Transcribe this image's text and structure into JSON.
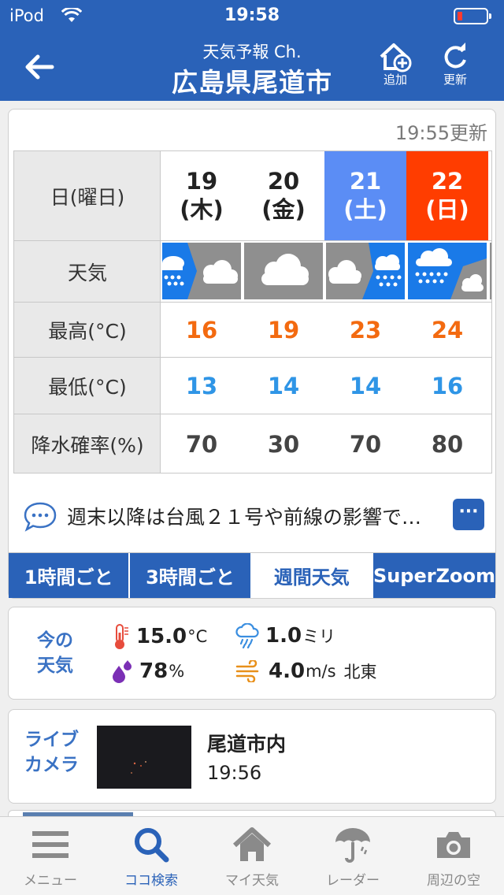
{
  "status_bar": {
    "carrier": "iPod",
    "time": "19:58",
    "battery_color": "#ff3b30"
  },
  "nav": {
    "subtitle": "天気予報 Ch.",
    "title": "広島県尾道市",
    "add_label": "追加",
    "refresh_label": "更新"
  },
  "forecast": {
    "updated": "19:55更新",
    "row_labels": {
      "day": "日(曜日)",
      "weather": "天気",
      "high": "最高(°C)",
      "low": "最低(°C)",
      "pop": "降水確率(%)"
    },
    "days": [
      {
        "date": "19",
        "weekday": "(木)",
        "weather": "rain-to-cloudy",
        "high": "16",
        "low": "13",
        "pop": "70"
      },
      {
        "date": "20",
        "weekday": "(金)",
        "weather": "cloudy",
        "high": "19",
        "low": "14",
        "pop": "30"
      },
      {
        "date": "21",
        "weekday": "(土)",
        "weather": "cloudy-to-rain",
        "high": "23",
        "low": "14",
        "pop": "70"
      },
      {
        "date": "22",
        "weekday": "(日)",
        "weather": "rain-to-cloudy",
        "high": "24",
        "low": "16",
        "pop": "80"
      }
    ],
    "comment": "週末以降は台風２１号や前線の影響で…",
    "more_label": "···",
    "tabs": [
      "1時間ごと",
      "3時間ごと",
      "週間天気",
      "SuperZoom"
    ],
    "active_tab": "週間天気",
    "colors": {
      "saturday": "#5b8df5",
      "sunday": "#ff3d00",
      "high": "#f36a10",
      "low": "#2f95e6",
      "rain": "#1a7ae8",
      "cloud": "#8f8f8f"
    }
  },
  "current": {
    "label_line1": "今の",
    "label_line2": "天気",
    "temperature": "15.0",
    "temperature_unit": "°C",
    "precip": "1.0",
    "precip_unit": "ミリ",
    "humidity": "78",
    "humidity_unit": "%",
    "wind": "4.0",
    "wind_unit": "m/s",
    "wind_dir": "北東"
  },
  "camera": {
    "label_line1": "ライブ",
    "label_line2": "カメラ",
    "name": "尾道市内",
    "time": "19:56"
  },
  "tabbar": {
    "items": [
      {
        "label": "メニュー",
        "icon": "menu-icon"
      },
      {
        "label": "ココ検索",
        "icon": "search-icon"
      },
      {
        "label": "マイ天気",
        "icon": "home-icon"
      },
      {
        "label": "レーダー",
        "icon": "umbrella-icon"
      },
      {
        "label": "周辺の空",
        "icon": "camera-icon"
      }
    ],
    "active_index": 1
  }
}
